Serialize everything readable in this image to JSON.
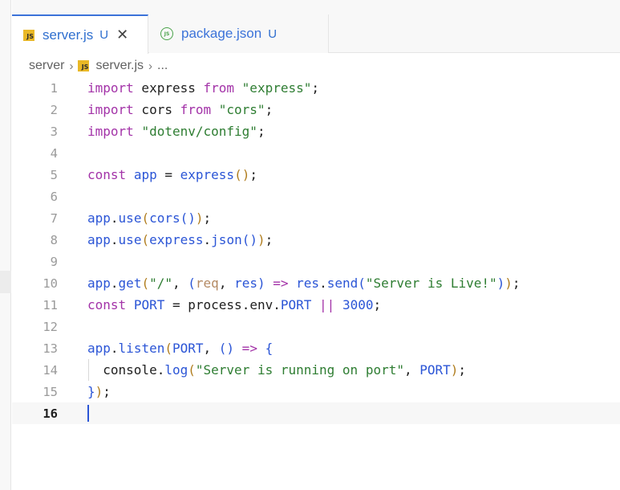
{
  "tabs": [
    {
      "icon": "javascript-file-icon",
      "name": "server.js",
      "status": "U",
      "close": "✕",
      "active": true
    },
    {
      "icon": "json-file-icon",
      "name": "package.json",
      "status": "U",
      "active": false
    }
  ],
  "breadcrumb": {
    "folder": "server",
    "file": "server.js",
    "more": "..."
  },
  "editor": {
    "line_numbers": [
      "1",
      "2",
      "3",
      "4",
      "5",
      "6",
      "7",
      "8",
      "9",
      "10",
      "11",
      "12",
      "13",
      "14",
      "15",
      "16"
    ],
    "current_line": 16,
    "code": {
      "l1": [
        "import",
        " express ",
        "from",
        " ",
        "\"express\"",
        ";"
      ],
      "l2": [
        "import",
        " cors ",
        "from",
        " ",
        "\"cors\"",
        ";"
      ],
      "l3": [
        "import",
        " ",
        "\"dotenv/config\"",
        ";"
      ],
      "l5": [
        "const",
        " ",
        "app",
        " = ",
        "express",
        "(",
        ")",
        ";"
      ],
      "l7": [
        "app",
        ".",
        "use",
        "(",
        "cors",
        "()",
        ")",
        ";"
      ],
      "l8": [
        "app",
        ".",
        "use",
        "(",
        "express",
        ".",
        "json",
        "()",
        ")",
        ";"
      ],
      "l10": [
        "app",
        ".",
        "get",
        "(",
        "\"/\"",
        ", ",
        "(",
        "req",
        ", ",
        "res",
        ")",
        " => ",
        "res",
        ".",
        "send",
        "(",
        "\"Server is Live!\"",
        ")",
        ")",
        ";"
      ],
      "l11": [
        "const",
        " ",
        "PORT",
        " = ",
        "process",
        ".",
        "env",
        ".",
        "PORT",
        " ",
        "||",
        " ",
        "3000",
        ";"
      ],
      "l13": [
        "app",
        ".",
        "listen",
        "(",
        "PORT",
        ", ",
        "()",
        " => ",
        "{"
      ],
      "l14": [
        "  ",
        "console",
        ".",
        "log",
        "(",
        "\"Server is running on port\"",
        ", ",
        "PORT",
        ")",
        ";"
      ],
      "l15": [
        "}",
        ")",
        ";"
      ]
    }
  },
  "colors": {
    "keyword": "#a333a8",
    "string": "#2e7d32",
    "function": "#2b55d6",
    "bracket": "#b07d1e",
    "accent": "#3b73d9"
  }
}
